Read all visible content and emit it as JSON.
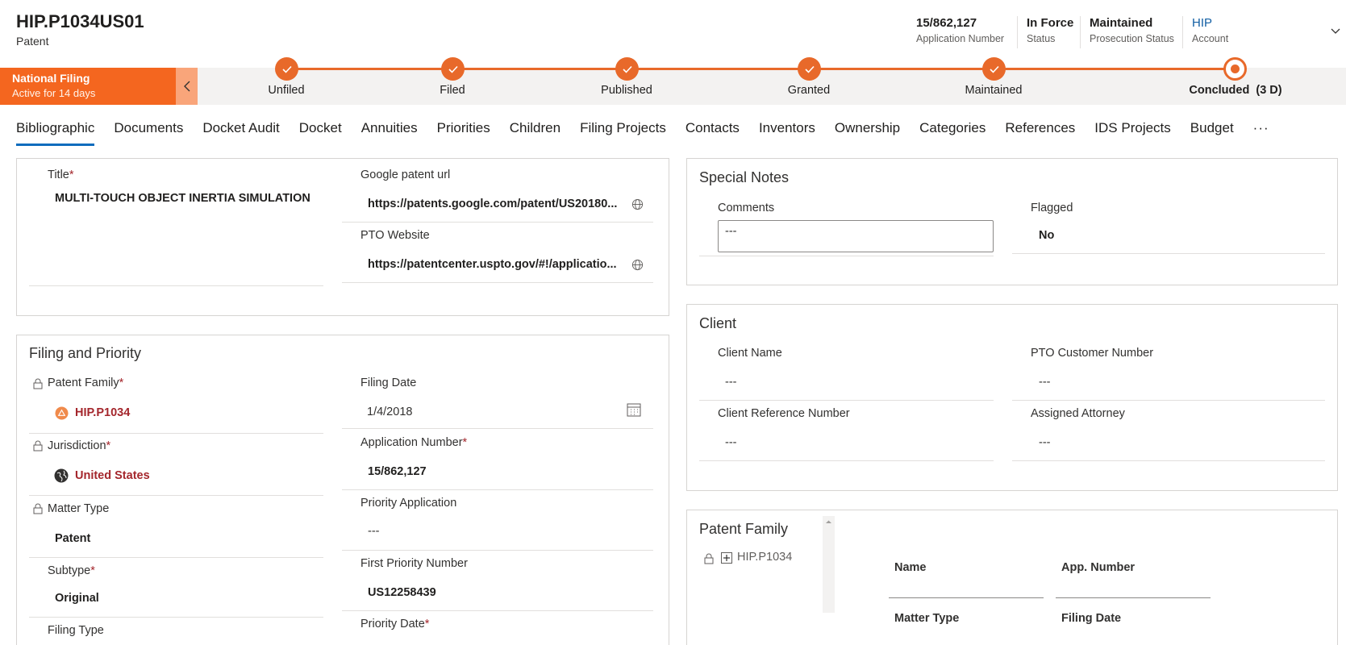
{
  "record": {
    "title": "HIP.P1034US01",
    "type": "Patent"
  },
  "header_fields": [
    {
      "value": "15/862,127",
      "label": "Application Number"
    },
    {
      "value": "In Force",
      "label": "Status"
    },
    {
      "value": "Maintained",
      "label": "Prosecution Status"
    },
    {
      "value": "HIP",
      "label": "Account"
    }
  ],
  "process": {
    "active_stage_name": "National Filing",
    "active_stage_duration": "Active for 14 days",
    "stages": [
      {
        "label": "Unfiled",
        "state": "done"
      },
      {
        "label": "Filed",
        "state": "done"
      },
      {
        "label": "Published",
        "state": "done"
      },
      {
        "label": "Granted",
        "state": "done"
      },
      {
        "label": "Maintained",
        "state": "done"
      },
      {
        "label": "Concluded",
        "state": "current",
        "suffix": "(3 D)"
      }
    ],
    "accent_color": "#E8692A"
  },
  "tabs": [
    "Bibliographic",
    "Documents",
    "Docket Audit",
    "Docket",
    "Annuities",
    "Priorities",
    "Children",
    "Filing Projects",
    "Contacts",
    "Inventors",
    "Ownership",
    "Categories",
    "References",
    "IDS Projects",
    "Budget",
    "···"
  ],
  "summary": {
    "title_label": "Title",
    "title_value": "MULTI-TOUCH OBJECT INERTIA SIMULATION",
    "google_label": "Google patent url",
    "google_value": "https://patents.google.com/patent/US20180...",
    "pto_label": "PTO Website",
    "pto_value": "https://patentcenter.uspto.gov/#!/applicatio..."
  },
  "filing": {
    "section_title": "Filing and Priority",
    "patent_family_label": "Patent Family",
    "patent_family_value": "HIP.P1034",
    "jurisdiction_label": "Jurisdiction",
    "jurisdiction_value": "United States",
    "matter_type_label": "Matter Type",
    "matter_type_value": "Patent",
    "subtype_label": "Subtype",
    "subtype_value": "Original",
    "filing_type_label": "Filing Type",
    "filing_date_label": "Filing Date",
    "filing_date_value": "1/4/2018",
    "app_number_label": "Application Number",
    "app_number_value": "15/862,127",
    "priority_app_label": "Priority Application",
    "priority_app_value": "---",
    "first_priority_label": "First Priority Number",
    "first_priority_value": "US12258439",
    "priority_date_label": "Priority Date"
  },
  "special_notes": {
    "section_title": "Special Notes",
    "comments_label": "Comments",
    "comments_value": "---",
    "flagged_label": "Flagged",
    "flagged_value": "No"
  },
  "client": {
    "section_title": "Client",
    "client_name_label": "Client Name",
    "client_name_value": "---",
    "pto_customer_label": "PTO Customer Number",
    "pto_customer_value": "---",
    "client_ref_label": "Client Reference Number",
    "client_ref_value": "---",
    "attorney_label": "Assigned Attorney",
    "attorney_value": "---"
  },
  "patent_family_panel": {
    "section_title": "Patent Family",
    "tree_item": "HIP.P1034",
    "col_name": "Name",
    "col_app_number": "App. Number",
    "col_matter_type": "Matter Type",
    "col_filing_date": "Filing Date"
  }
}
